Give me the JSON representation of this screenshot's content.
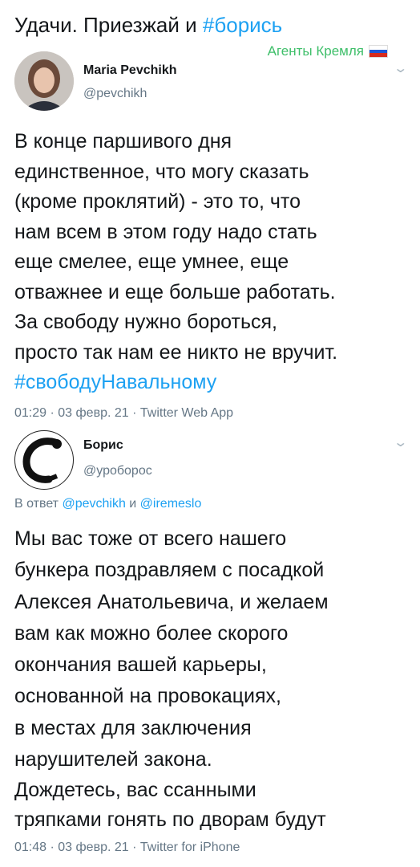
{
  "header": {
    "text": "Удачи. Приезжай и ",
    "hashtag": "#борись"
  },
  "watermark": {
    "text": "Агенты Кремля",
    "flag_colors": [
      "#ffffff",
      "#1c57d6",
      "#d52b1e"
    ]
  },
  "tweet1": {
    "name": "Maria Pevchikh",
    "handle": "@pevchikh",
    "lines": [
      "В конце паршивого дня",
      "единственное, что могу сказать",
      "(кроме проклятий) - это то, что",
      "нам всем в этом году надо стать",
      "еще смелее, еще умнее, еще",
      "отважнее и еще больше работать.",
      "За свободу нужно бороться,",
      "просто так нам ее никто не вручит."
    ],
    "hashtag": "#свободуНавальному",
    "meta": "01:29 · 03 февр. 21 · Twitter Web App"
  },
  "tweet2": {
    "name": "Борис",
    "handle": "@уроборос",
    "reply_prefix": "В ответ ",
    "reply_user1": "@pevchikh",
    "reply_and": " и ",
    "reply_user2": "@iremeslo",
    "lines": [
      "Мы вас тоже от всего нашего",
      "бункера поздравляем с посадкой",
      "Алексея Анатольевича, и желаем",
      "вам как можно более скорого",
      "окончания вашей карьеры,",
      "основанной на провокациях,",
      "в местах для заключения",
      "нарушителей закона."
    ],
    "lines2": [
      "Дождетесь, вас ссанными",
      "тряпками гонять по дворам будут"
    ],
    "meta": "01:48 · 03 февр. 21 · Twitter for iPhone"
  },
  "colors": {
    "link": "#1da1f2",
    "muted": "#657786",
    "watermark": "#3fbf6a"
  }
}
